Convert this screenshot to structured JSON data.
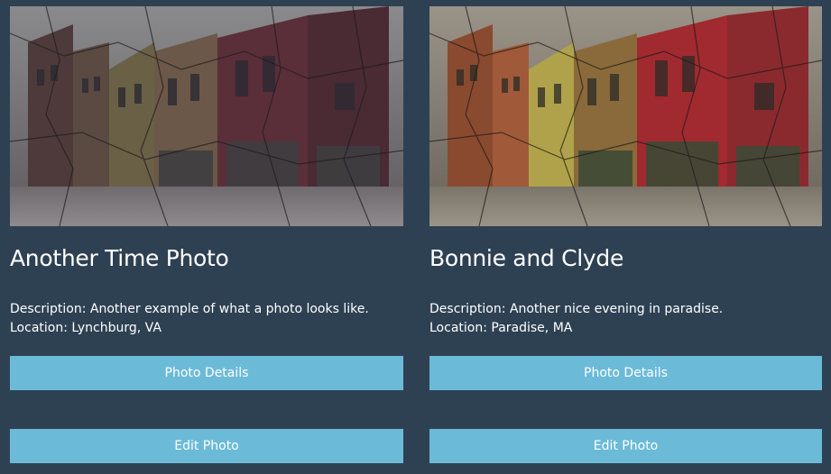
{
  "cards": [
    {
      "title": "Another Time Photo",
      "description": "Description: Another example of what a photo looks like.",
      "location": "Location: Lynchburg, VA",
      "details_label": "Photo Details",
      "edit_label": "Edit Photo"
    },
    {
      "title": "Bonnie and Clyde",
      "description": "Description: Another nice evening in paradise.",
      "location": "Location: Paradise, MA",
      "details_label": "Photo Details",
      "edit_label": "Edit Photo"
    }
  ],
  "colors": {
    "background": "#2e4153",
    "button": "#6bbad8",
    "text": "#ffffff"
  }
}
